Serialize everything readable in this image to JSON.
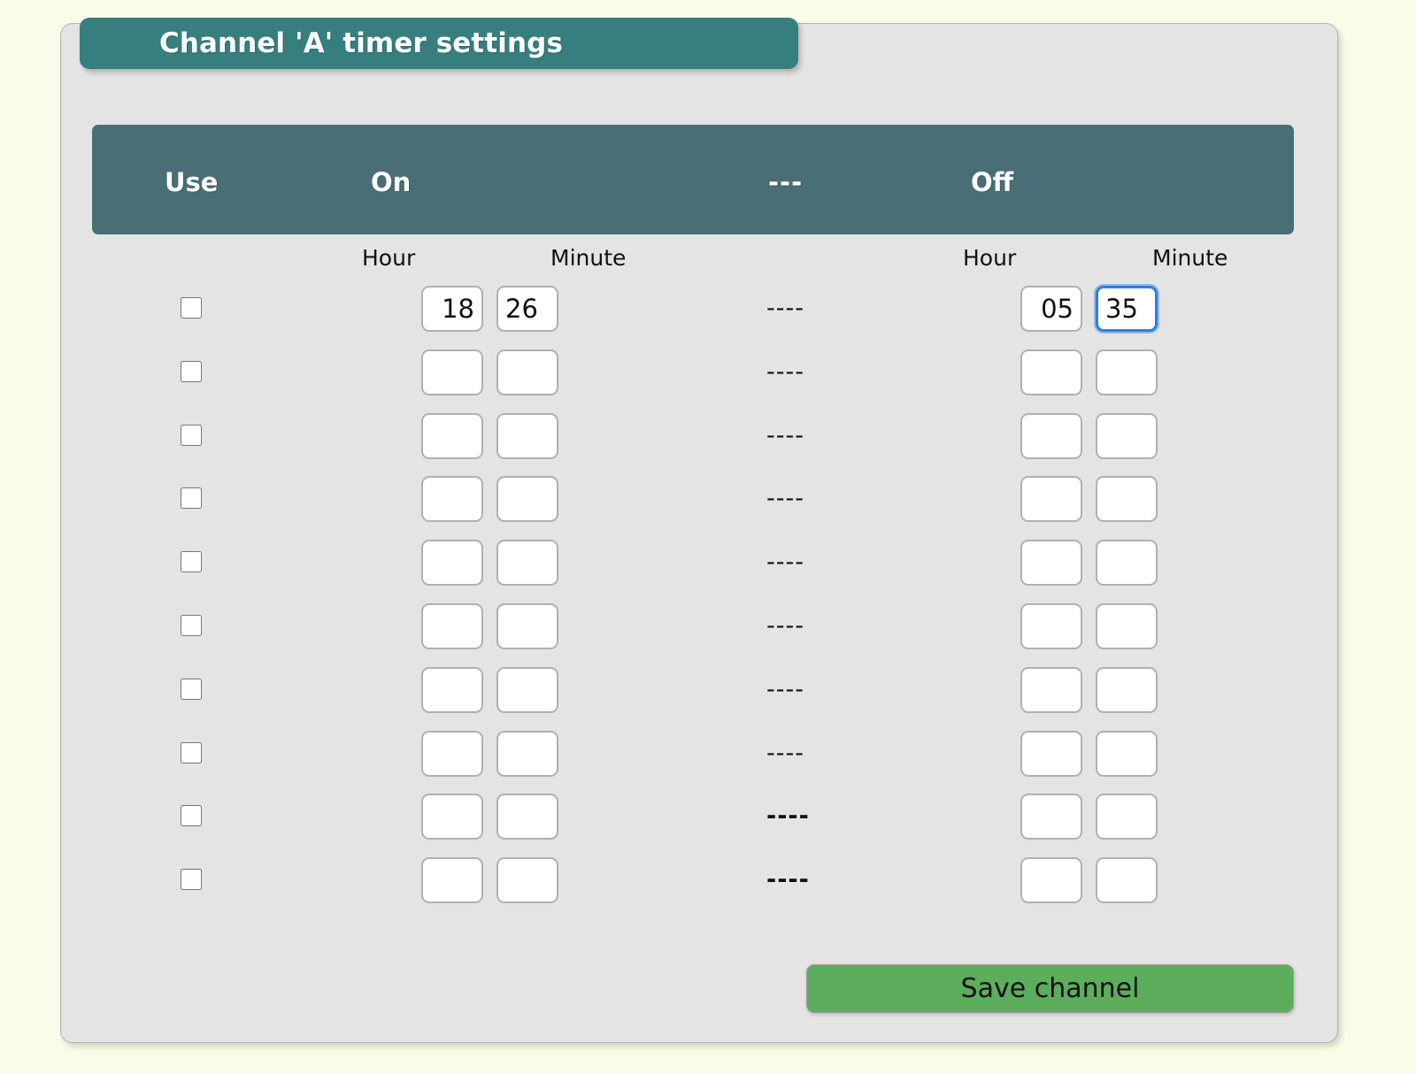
{
  "page": {
    "background_color": "#fbfbe9"
  },
  "panel": {
    "background_color": "#e4e4e4",
    "title_tab_color": "#367f7e",
    "title": "Channel 'A' timer settings"
  },
  "table": {
    "header_bar_color": "#4a6e76",
    "headers": {
      "use": "Use",
      "on": "On",
      "separator": "---",
      "off": "Off"
    },
    "sub_headers": {
      "on_hour": "Hour",
      "on_minute": "Minute",
      "off_hour": "Hour",
      "off_minute": "Minute"
    },
    "rows": [
      {
        "use": false,
        "on_hour": "18",
        "on_minute": "26",
        "separator": "----",
        "separator_bold": false,
        "off_hour": "05",
        "off_minute": "35",
        "focused_field": "off_minute"
      },
      {
        "use": false,
        "on_hour": "",
        "on_minute": "",
        "separator": "----",
        "separator_bold": false,
        "off_hour": "",
        "off_minute": "",
        "focused_field": ""
      },
      {
        "use": false,
        "on_hour": "",
        "on_minute": "",
        "separator": "----",
        "separator_bold": false,
        "off_hour": "",
        "off_minute": "",
        "focused_field": ""
      },
      {
        "use": false,
        "on_hour": "",
        "on_minute": "",
        "separator": "----",
        "separator_bold": false,
        "off_hour": "",
        "off_minute": "",
        "focused_field": ""
      },
      {
        "use": false,
        "on_hour": "",
        "on_minute": "",
        "separator": "----",
        "separator_bold": false,
        "off_hour": "",
        "off_minute": "",
        "focused_field": ""
      },
      {
        "use": false,
        "on_hour": "",
        "on_minute": "",
        "separator": "----",
        "separator_bold": false,
        "off_hour": "",
        "off_minute": "",
        "focused_field": ""
      },
      {
        "use": false,
        "on_hour": "",
        "on_minute": "",
        "separator": "----",
        "separator_bold": false,
        "off_hour": "",
        "off_minute": "",
        "focused_field": ""
      },
      {
        "use": false,
        "on_hour": "",
        "on_minute": "",
        "separator": "----",
        "separator_bold": false,
        "off_hour": "",
        "off_minute": "",
        "focused_field": ""
      },
      {
        "use": false,
        "on_hour": "",
        "on_minute": "",
        "separator": "----",
        "separator_bold": true,
        "off_hour": "",
        "off_minute": "",
        "focused_field": ""
      },
      {
        "use": false,
        "on_hour": "",
        "on_minute": "",
        "separator": "----",
        "separator_bold": true,
        "off_hour": "",
        "off_minute": "",
        "focused_field": ""
      }
    ]
  },
  "actions": {
    "save_label": "Save channel",
    "save_color": "#5cad5c"
  }
}
